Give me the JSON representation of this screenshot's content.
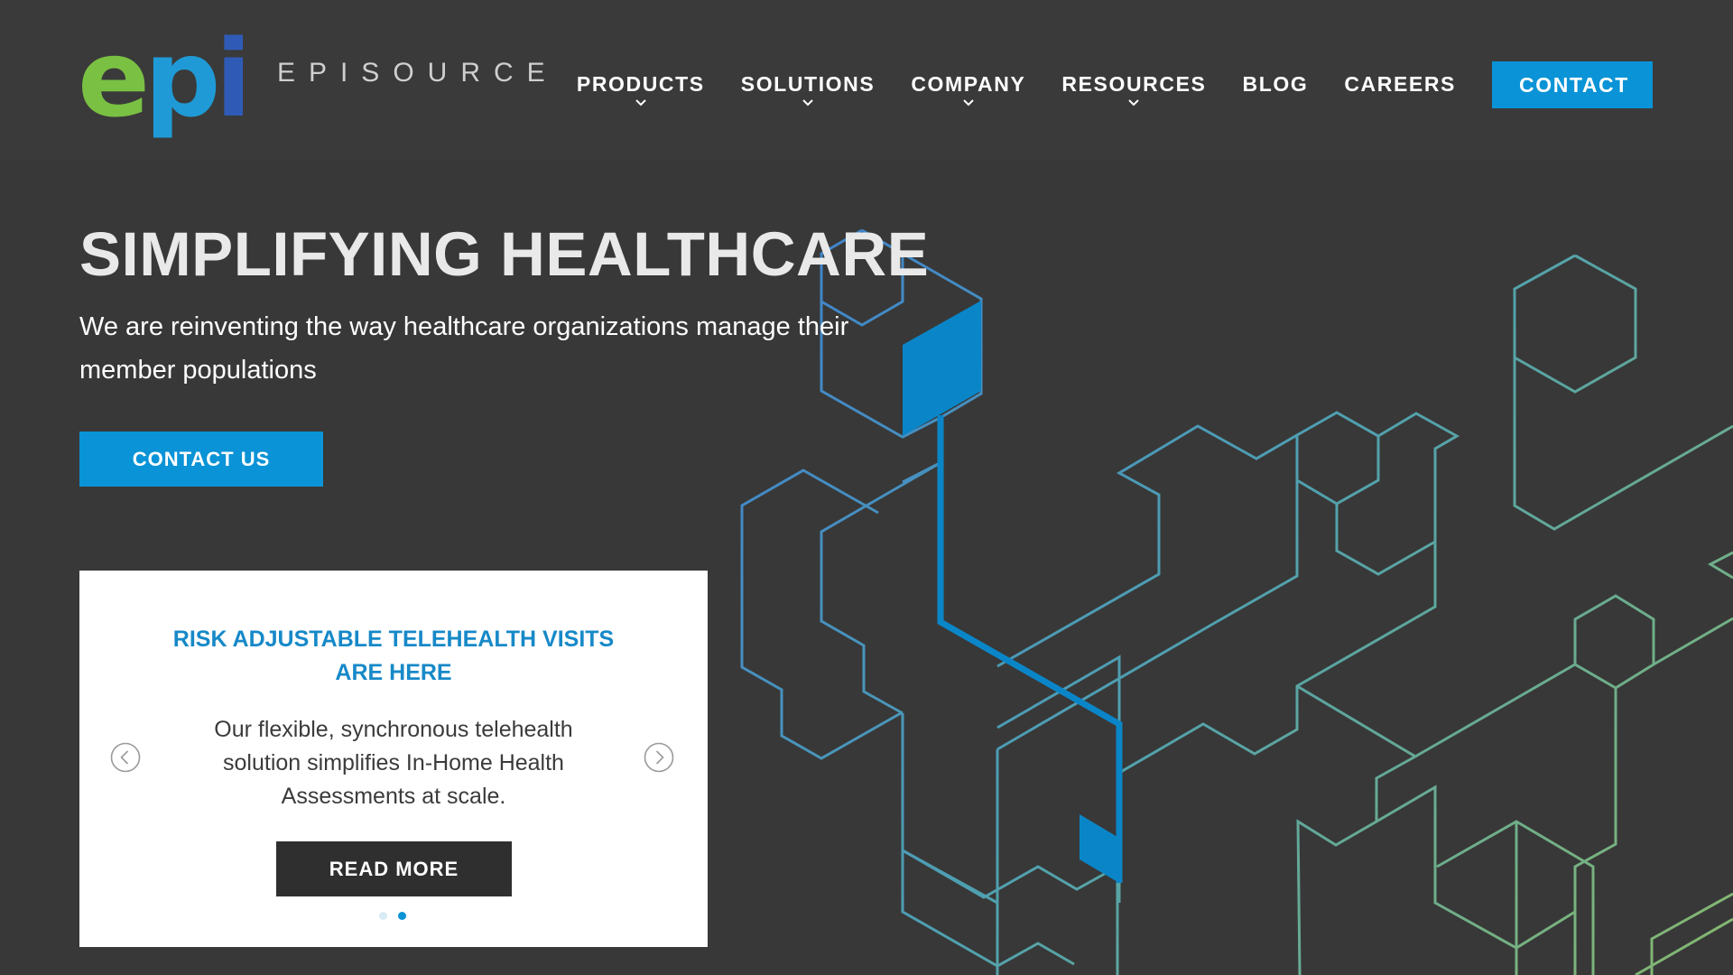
{
  "brand": {
    "logo_mark": {
      "e": "e",
      "p": "p",
      "i": "i"
    },
    "wordmark": "EPISOURCE",
    "colors": {
      "green": "#7ac143",
      "blue": "#1f9ad6",
      "dark_blue": "#2f5bb7",
      "accent": "#0a93d6",
      "background": "#383838"
    }
  },
  "nav": {
    "items": [
      {
        "label": "PRODUCTS",
        "has_dropdown": true
      },
      {
        "label": "SOLUTIONS",
        "has_dropdown": true
      },
      {
        "label": "COMPANY",
        "has_dropdown": true
      },
      {
        "label": "RESOURCES",
        "has_dropdown": true
      },
      {
        "label": "BLOG",
        "has_dropdown": false
      },
      {
        "label": "CAREERS",
        "has_dropdown": false
      }
    ],
    "contact_label": "CONTACT"
  },
  "hero": {
    "title": "SIMPLIFYING HEALTHCARE",
    "subtitle": "We are reinventing the way healthcare organizations manage their member populations",
    "cta_label": "CONTACT US"
  },
  "carousel": {
    "title": "RISK ADJUSTABLE TELEHEALTH VISITS ARE HERE",
    "text": "Our flexible, synchronous telehealth solution simplifies In-Home Health Assessments at scale.",
    "button_label": "READ MORE",
    "prev_icon": "chevron-left-icon",
    "next_icon": "chevron-right-icon",
    "slides_total": 2,
    "active_slide": 2
  }
}
